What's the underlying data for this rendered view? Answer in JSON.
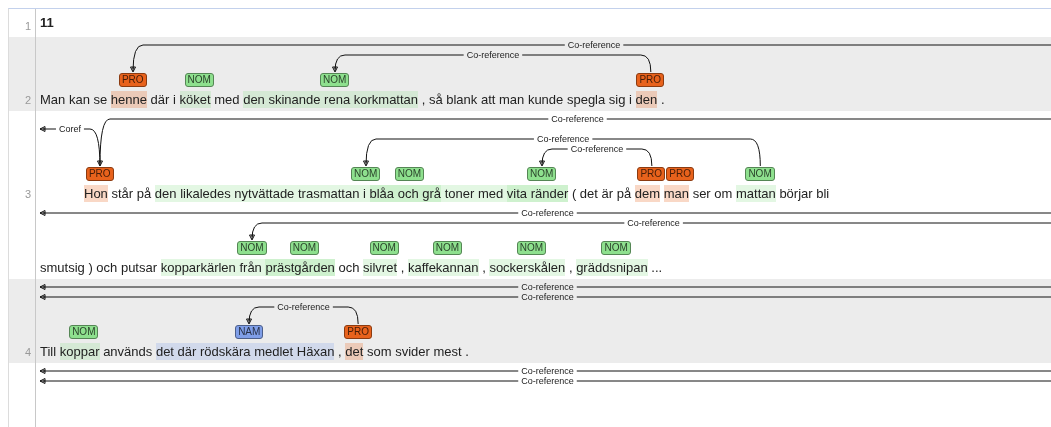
{
  "sentences": [
    {
      "kind": "heading",
      "number": "1",
      "shaded": false,
      "lines": [
        {
          "segments": [
            "11"
          ]
        }
      ]
    },
    {
      "kind": "text",
      "number": "2",
      "shaded": true,
      "lines": [
        {
          "segments": [
            "Man kan se",
            {
              "type": "PRO",
              "color": "#e8621c",
              "segments": [
                "henne"
              ]
            },
            "där i",
            {
              "type": "NOM",
              "color": "#8ee08e",
              "segments": [
                "köket"
              ]
            },
            "med",
            {
              "type": "NOM",
              "color": "#8ee08e",
              "segments": [
                "den skinande rena korkmattan"
              ]
            },
            ", så blank att man kunde spegla sig i",
            {
              "type": "PRO",
              "color": "#e8621c",
              "segments": [
                "den"
              ]
            },
            "."
          ],
          "arcs": [
            {
              "label": "Co-reference",
              "kind": "incoming"
            },
            {
              "label": "Co-reference",
              "kind": "link"
            }
          ]
        }
      ]
    },
    {
      "kind": "text",
      "number": "3",
      "shaded": false,
      "lines": [
        {
          "segments": [
            {
              "type": "PRO",
              "color": "#e8621c",
              "segments": [
                "Hon"
              ]
            },
            "står på",
            {
              "type": "NOM",
              "color": "#8ee08e",
              "segments": [
                "den likaledes nytvättade trasmattan i",
                {
                  "type": "NOM",
                  "color": "#8ee08e",
                  "segments": [
                    "blåa och grå"
                  ]
                },
                "toner med",
                {
                  "type": "NOM",
                  "color": "#8ee08e",
                  "segments": [
                    "vita ränder"
                  ]
                }
              ]
            },
            "( det är på",
            {
              "type": "PRO",
              "color": "#e8621c",
              "segments": [
                "dem"
              ]
            },
            {
              "type": "PRO",
              "color": "#e8621c",
              "segments": [
                "man"
              ]
            },
            "ser om",
            {
              "type": "NOM",
              "color": "#8ee08e",
              "segments": [
                "mattan"
              ]
            },
            "börjar bli"
          ],
          "arcs": [
            {
              "label": "Co-reference",
              "kind": "incoming"
            },
            {
              "label": "Coref",
              "kind": "outgoing"
            },
            {
              "label": "Co-reference",
              "kind": "link"
            },
            {
              "label": "Co-reference",
              "kind": "link"
            }
          ]
        },
        {
          "segments": [
            "smutsig ) och putsar",
            {
              "type": "NOM",
              "color": "#8ee08e",
              "segments": [
                "kopparkärlen från",
                {
                  "type": "NOM",
                  "color": "#8ee08e",
                  "segments": [
                    "prästgården"
                  ]
                }
              ]
            },
            "och",
            {
              "type": "NOM",
              "color": "#8ee08e",
              "segments": [
                "silvret"
              ]
            },
            ",",
            {
              "type": "NOM",
              "color": "#8ee08e",
              "segments": [
                "kaffekannan"
              ]
            },
            ",",
            {
              "type": "NOM",
              "color": "#8ee08e",
              "segments": [
                "sockerskålen"
              ]
            },
            ",",
            {
              "type": "NOM",
              "color": "#8ee08e",
              "segments": [
                "gräddsnipan"
              ]
            },
            "..."
          ],
          "arcs": [
            {
              "label": "Co-reference",
              "kind": "crossing"
            },
            {
              "label": "Co-reference",
              "kind": "incoming"
            }
          ]
        }
      ]
    },
    {
      "kind": "text",
      "number": "4",
      "shaded": true,
      "lines": [
        {
          "segments": [
            "Till",
            {
              "type": "NOM",
              "color": "#8ee08e",
              "segments": [
                "koppar"
              ]
            },
            "används",
            {
              "type": "NAM",
              "color": "#7f9ee8",
              "segments": [
                "det där rödskära medlet Häxan"
              ]
            },
            ",",
            {
              "type": "PRO",
              "color": "#e8621c",
              "segments": [
                "det"
              ]
            },
            "som svider mest ."
          ],
          "arcs": [
            {
              "label": "Co-reference",
              "kind": "crossing"
            },
            {
              "label": "Co-reference",
              "kind": "crossing"
            },
            {
              "label": "Co-reference",
              "kind": "link"
            }
          ]
        }
      ]
    },
    {
      "shaded": false,
      "lines": [
        {
          "arcs": [
            {
              "label": "Co-reference",
              "kind": "crossing"
            },
            {
              "label": "Co-reference",
              "kind": "crossing"
            }
          ]
        }
      ]
    }
  ]
}
